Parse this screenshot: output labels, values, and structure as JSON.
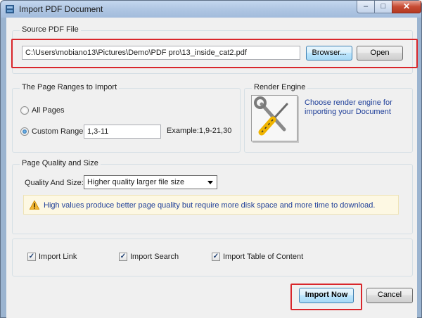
{
  "window": {
    "title": "Import PDF Document",
    "controls": {
      "minimize": "–",
      "maximize": "□",
      "close": "✕"
    }
  },
  "source": {
    "group_title": "Source PDF File",
    "file_path": "C:\\Users\\mobiano13\\Pictures\\Demo\\PDF pro\\13_inside_cat2.pdf",
    "browse_label": "Browser...",
    "open_label": "Open"
  },
  "page_ranges": {
    "group_title": "The Page Ranges to Import",
    "all_pages_label": "All Pages",
    "custom_range_label": "Custom Range",
    "custom_range_value": "1,3-11",
    "example_text": "Example:1,9-21,30",
    "selected": "custom"
  },
  "render_engine": {
    "group_title": "Render Engine",
    "description": "Choose render engine for importing your Document",
    "icon": "tools-icon"
  },
  "quality": {
    "group_title": "Page Quality and Size",
    "select_label": "Quality And Size:",
    "selected_option": "Higher quality larger file size",
    "warning_text": "High values produce better page quality but require more disk space and more time to download.",
    "warning_icon": "warning-icon"
  },
  "options": {
    "import_link_label": "Import Link",
    "import_search_label": "Import Search",
    "import_toc_label": "Import Table of Content",
    "import_link_checked": true,
    "import_search_checked": true,
    "import_toc_checked": true
  },
  "footer": {
    "import_now_label": "Import Now",
    "cancel_label": "Cancel"
  },
  "colors": {
    "highlight": "#d9262b",
    "link_text": "#1f3f99",
    "warning_bg": "#fdf8e3"
  }
}
